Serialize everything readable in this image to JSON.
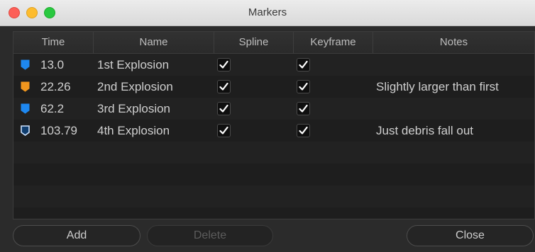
{
  "window": {
    "title": "Markers"
  },
  "table": {
    "headers": [
      "Time",
      "Name",
      "Spline",
      "Keyframe",
      "Notes"
    ],
    "rows": [
      {
        "time": "13.0",
        "name": "1st Explosion",
        "spline": true,
        "keyframe": true,
        "notes": "",
        "marker_color": "#1e88f0",
        "marker_style": "filled"
      },
      {
        "time": "22.26",
        "name": "2nd Explosion",
        "spline": true,
        "keyframe": true,
        "notes": "Slightly larger than first",
        "marker_color": "#f0961e",
        "marker_style": "filled"
      },
      {
        "time": "62.2",
        "name": "3rd Explosion",
        "spline": true,
        "keyframe": true,
        "notes": "",
        "marker_color": "#1e88f0",
        "marker_style": "filled"
      },
      {
        "time": "103.79",
        "name": "4th Explosion",
        "spline": true,
        "keyframe": true,
        "notes": "Just debris fall out",
        "marker_color": "#1e88f0",
        "marker_style": "outlined"
      }
    ]
  },
  "buttons": {
    "add": "Add",
    "delete": "Delete",
    "close": "Close"
  },
  "colors": {
    "marker_blue": "#1e88f0",
    "marker_orange": "#f0961e"
  }
}
